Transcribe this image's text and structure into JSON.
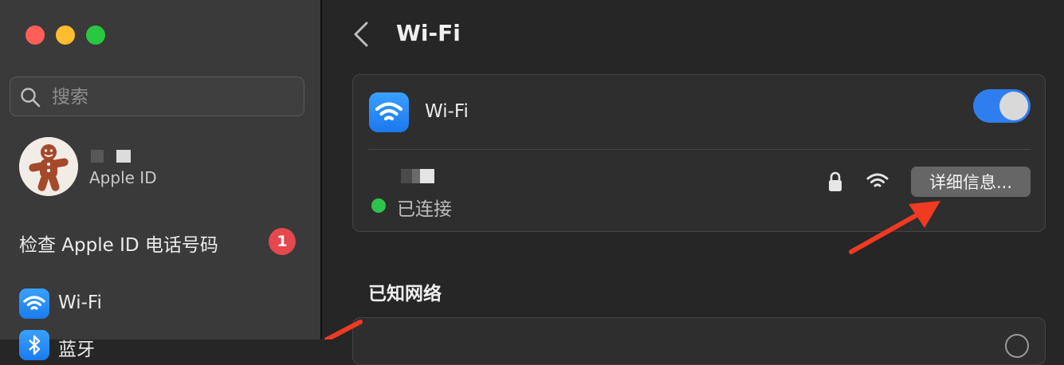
{
  "window": {
    "buttons": {
      "close": "close",
      "minimize": "minimize",
      "zoom": "zoom"
    }
  },
  "sidebar": {
    "search": {
      "placeholder": "搜索",
      "icon": "search-icon"
    },
    "account": {
      "subtitle": "Apple ID"
    },
    "check_apple_id": {
      "label": "检查 Apple ID 电话号码",
      "badge": "1"
    },
    "items": [
      {
        "label": "Wi-Fi",
        "icon": "wifi-icon"
      },
      {
        "label": "蓝牙",
        "icon": "bluetooth-icon"
      }
    ]
  },
  "main": {
    "title": "Wi-Fi",
    "wifi_card": {
      "label": "Wi-Fi",
      "toggle_on": true,
      "status": "已连接",
      "details_button": "详细信息..."
    },
    "known_networks": {
      "title": "已知网络"
    }
  },
  "colors": {
    "accent": "#2f7ef0",
    "status_connected": "#2fc24a",
    "badge": "#e5484d",
    "annotation_arrow": "#f03a22"
  }
}
